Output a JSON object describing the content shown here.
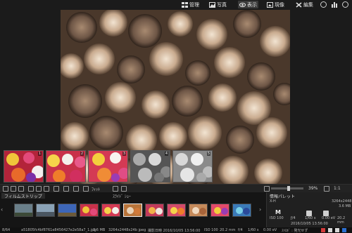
{
  "topbar": {
    "nav": [
      {
        "label": "管理",
        "icon": "grid-icon"
      },
      {
        "label": "写真",
        "icon": "photo-icon"
      },
      {
        "label": "表示",
        "icon": "eye-icon"
      },
      {
        "label": "現像",
        "icon": "develop-icon"
      },
      {
        "label": "編集",
        "icon": "tools-icon"
      }
    ]
  },
  "thumbs": [
    {
      "num": "1"
    },
    {
      "num": "2"
    },
    {
      "num": "3"
    },
    {
      "num": "4"
    },
    {
      "num": "5"
    }
  ],
  "toolbar": {
    "fit_label": "ﾌｨｯﾄ",
    "zoom_value": "39%",
    "ratio": "1:1"
  },
  "filmstrip": {
    "tab_label": "フィルムストリップ",
    "mid_label": "ｽﾗｲﾄﾞ  ｼｮｰ"
  },
  "palette": {
    "title": "情報パレット",
    "cam_label": "X-H",
    "size1": "3264x2448",
    "size2": "3.6 MB",
    "mode": "M",
    "iso": "ISO 100",
    "aperture": "ƒ/4",
    "shutter": "1/60 s",
    "ev": "0.00 eV",
    "focal": "20.2 mm",
    "date": "2016/10/05  13:56:00"
  },
  "statusbar": {
    "count": "8/64",
    "filename": "a51805fc4bf8761e8456427e2e58a7_1.jpg",
    "filesize": "3.6 MB",
    "dims": "3264x2448x24b jpeg",
    "taken": "撮影日時 2016/10/05 13:56:00",
    "iso": "ISO 100",
    "focal": "20.2 mm",
    "aperture": "f/4",
    "shutter": "1/60 s",
    "ev": "0.00 eV",
    "extra": "ｽﾄﾛﾎﾞ : 発光せず"
  }
}
